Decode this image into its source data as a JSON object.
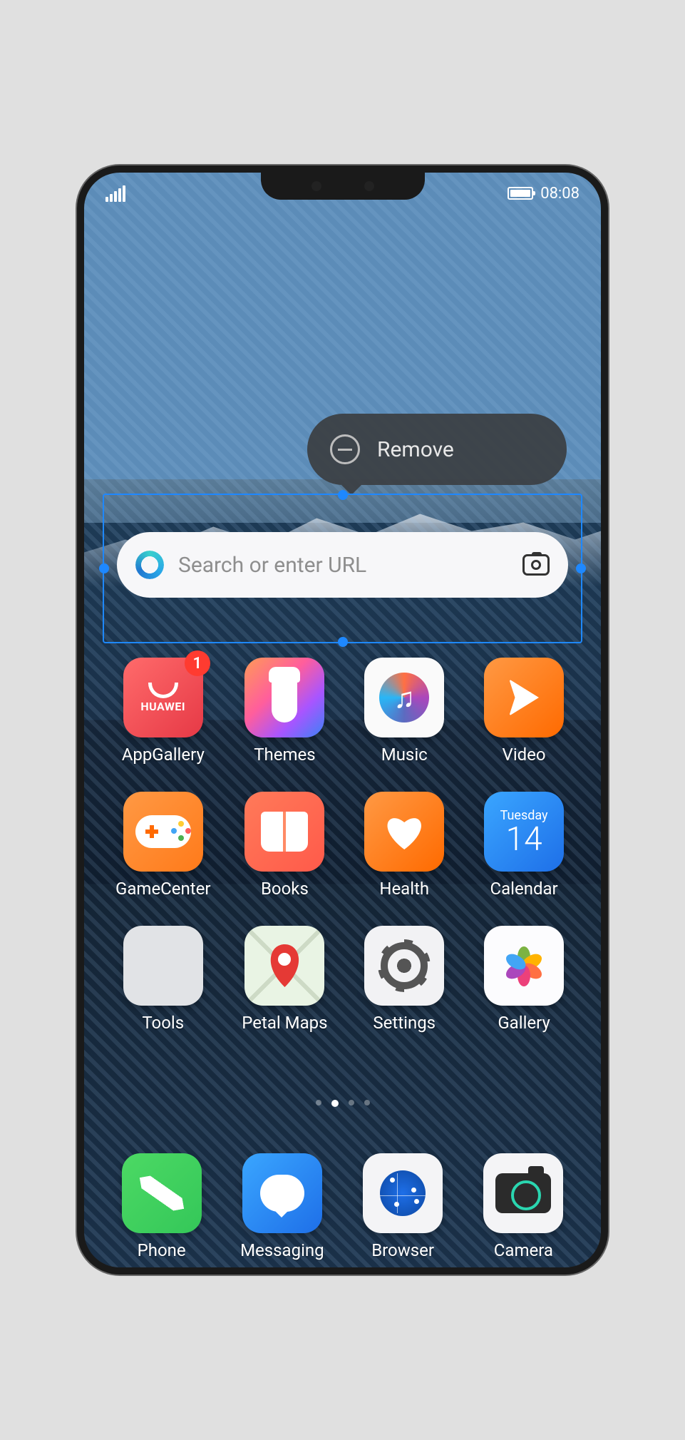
{
  "status": {
    "time": "08:08"
  },
  "popover": {
    "remove_label": "Remove"
  },
  "search": {
    "placeholder": "Search or enter URL"
  },
  "apps": {
    "appgallery": {
      "label": "AppGallery",
      "brand": "HUAWEI",
      "badge": "1"
    },
    "themes": {
      "label": "Themes"
    },
    "music": {
      "label": "Music"
    },
    "video": {
      "label": "Video"
    },
    "gamecenter": {
      "label": "GameCenter"
    },
    "books": {
      "label": "Books"
    },
    "health": {
      "label": "Health"
    },
    "calendar": {
      "label": "Calendar",
      "dow": "Tuesday",
      "day": "14"
    },
    "tools": {
      "label": "Tools"
    },
    "petalmaps": {
      "label": "Petal Maps"
    },
    "settings": {
      "label": "Settings"
    },
    "gallery": {
      "label": "Gallery"
    }
  },
  "dock": {
    "phone": {
      "label": "Phone"
    },
    "messaging": {
      "label": "Messaging"
    },
    "browser": {
      "label": "Browser"
    },
    "camera": {
      "label": "Camera"
    }
  }
}
